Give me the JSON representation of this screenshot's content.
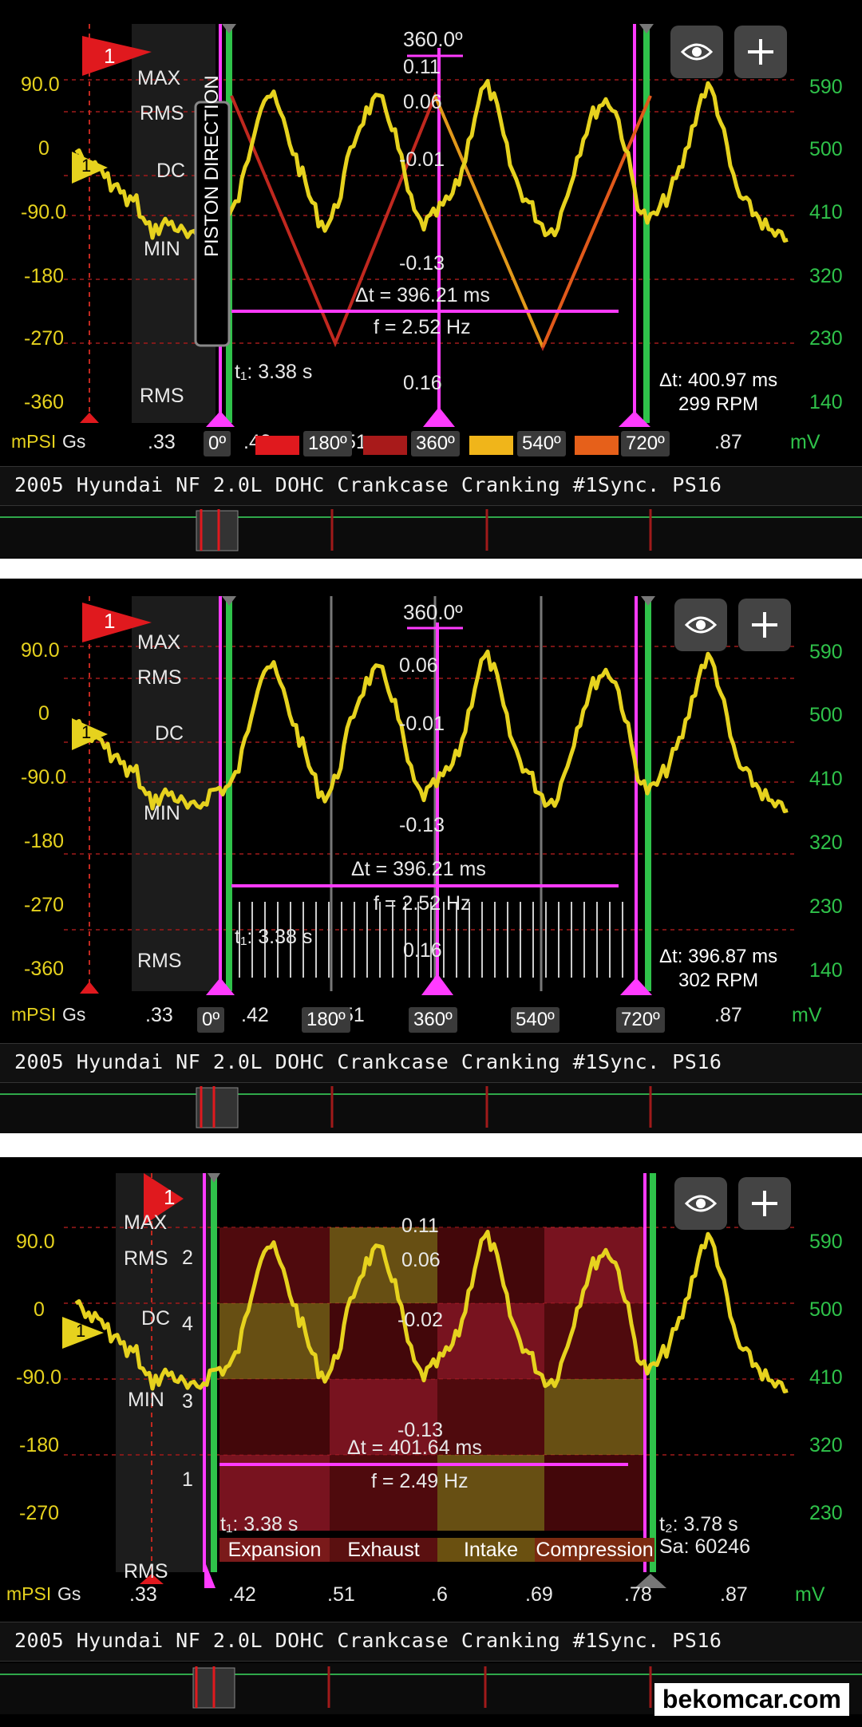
{
  "trace_title": "2005 Hyundai NF 2.0L DOHC Crankcase Cranking #1Sync. PS16",
  "units": {
    "left": "mPSI",
    "left_suffix": "Gs",
    "right": "mV"
  },
  "left_axis": [
    "90.0",
    "0",
    "-90.0",
    "-180",
    "-270",
    "-360"
  ],
  "left_axis_3": [
    "90.0",
    "0",
    "-90.0",
    "-180",
    "-270"
  ],
  "right_axis": [
    "590",
    "500",
    "410",
    "320",
    "230",
    "140"
  ],
  "right_axis_3": [
    "590",
    "500",
    "410",
    "320",
    "230"
  ],
  "x_ticks": [
    ".33",
    ".42",
    ".51",
    ".6",
    ".69",
    ".78",
    ".87"
  ],
  "stat_labels": {
    "max": "MAX",
    "rms": "RMS",
    "dc": "DC",
    "min": "MIN"
  },
  "ruler_values": [
    "0.11",
    "0.06",
    "-0.01",
    "-0.13",
    "0.16"
  ],
  "ruler_values_3": [
    "0.11",
    "0.06",
    "-0.02",
    "-0.13"
  ],
  "angles": {
    "top": "360.0º",
    "a0": "0º",
    "a180": "180º",
    "a360": "360º",
    "a540": "540º",
    "a720": "720º"
  },
  "trigger_marker": "1",
  "piston_direction": "PISTON DIRECTION",
  "panel1": {
    "dt": "Δt = 396.21 ms",
    "freq": "f = 2.52 Hz",
    "t1": "t₁: 3.38 s",
    "tip_dt": "Δt: 400.97 ms",
    "tip_rpm": "299 RPM"
  },
  "panel2": {
    "dt": "Δt = 396.21 ms",
    "freq": "f = 2.52 Hz",
    "t1": "t₁: 3.38 s",
    "tip_dt": "Δt: 396.87 ms",
    "tip_rpm": "302 RPM"
  },
  "panel3": {
    "dt": "Δt = 401.64 ms",
    "freq": "f = 2.49 Hz",
    "t1": "t₁: 3.38 s",
    "t2": "t₂: 3.78 s",
    "sa": "Sa: 60246",
    "cyl_numbers": [
      "2",
      "4",
      "3",
      "1"
    ],
    "strokes": [
      "Expansion",
      "Exhaust",
      "Intake",
      "Compression"
    ]
  },
  "watermark": "bekomcar.com",
  "colors": {
    "trace": "#e6d21e",
    "cursor": "#ff3bff",
    "green": "#2fc24a",
    "red": "#e0191e"
  }
}
